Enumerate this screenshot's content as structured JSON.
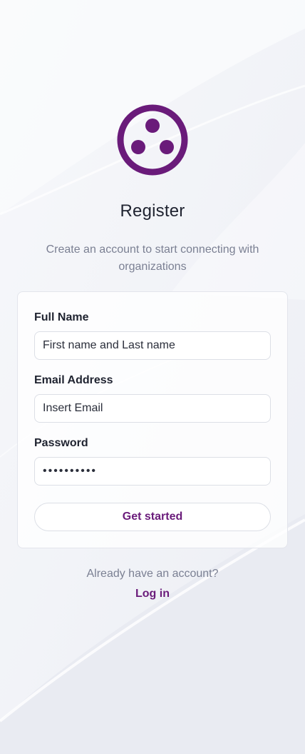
{
  "brand": {
    "color": "#6a1b7a",
    "logo_icon": "three-dots-circle-logo"
  },
  "header": {
    "title": "Register",
    "subtitle": "Create an account to start connecting with organizations"
  },
  "form": {
    "full_name": {
      "label": "Full Name",
      "placeholder": "First name and Last name",
      "value": ""
    },
    "email": {
      "label": "Email Address",
      "placeholder": "Insert Email",
      "value": ""
    },
    "password": {
      "label": "Password",
      "value": "••••••••••"
    },
    "submit_label": "Get started"
  },
  "footer": {
    "prompt": "Already have an account?",
    "login_label": "Log in"
  }
}
